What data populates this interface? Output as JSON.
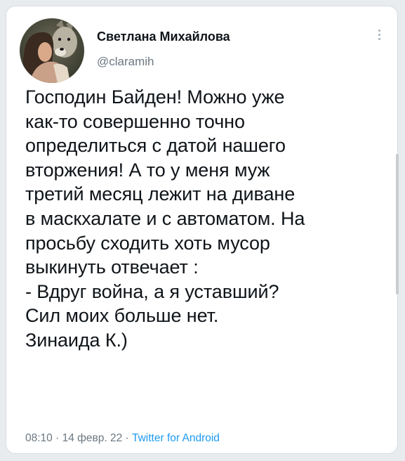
{
  "author": {
    "name": "Светлана Михайлова",
    "handle": "@claramih",
    "avatar_icon": "profile-photo-woman-with-dog"
  },
  "tweet": {
    "text_lines": [
      "Господин Байден!  Можно уже",
      "как-то совершенно точно",
      "определиться с датой нашего",
      "вторжения! А то у меня муж",
      "третий месяц лежит на диване",
      "в маскхалате и с автоматом. На",
      "просьбу сходить хоть мусор",
      "выкинуть отвечает :",
      "- Вдруг война, а я уставший?",
      "Сил моих больше нет.",
      "Зинаида К.)"
    ]
  },
  "meta": {
    "time": "08:10",
    "separator": " · ",
    "date": "14 февр. 22",
    "source": "Twitter for Android"
  },
  "menu": {
    "icon": "more-vertical-icon"
  },
  "colors": {
    "text": "#0f1419",
    "secondary": "#6b7781",
    "link": "#1d9bf0",
    "card_border": "#d6dbe0"
  }
}
